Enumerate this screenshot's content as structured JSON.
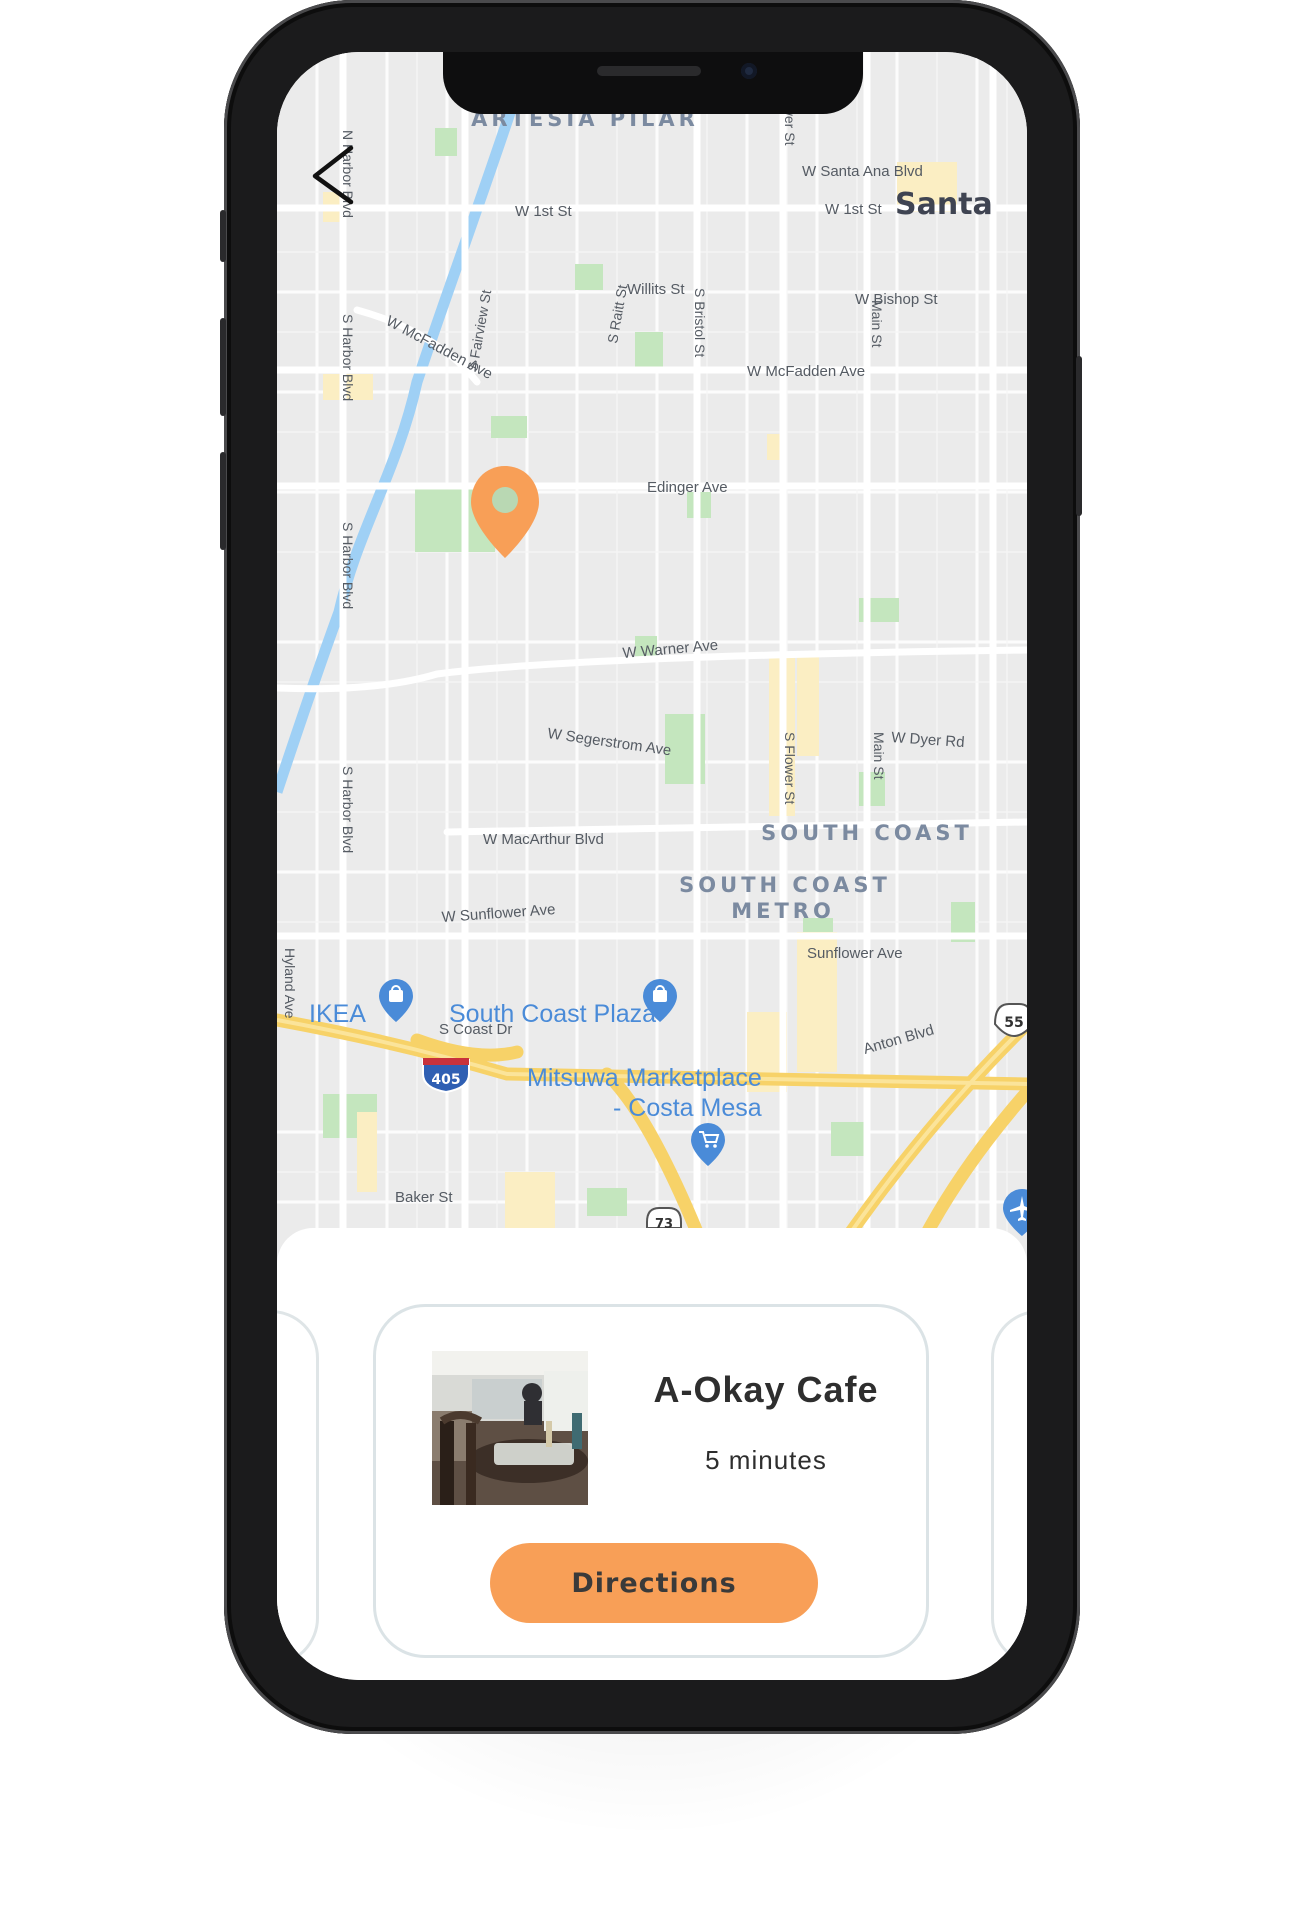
{
  "map": {
    "areas": [
      "ARTESIA PILAR",
      "SOUTH COAST",
      "SOUTH COAST",
      "METRO"
    ],
    "city_partial": "Santa",
    "streets": {
      "w_santa_ana": "W Santa Ana Blvd",
      "w_1st_a": "W 1st St",
      "w_1st_b": "W 1st St",
      "willits": "Willits St",
      "w_bishop": "W Bishop St",
      "w_mcfadden_a": "W McFadden Ave",
      "w_mcfadden_b": "W McFadden Ave",
      "edinger": "Edinger Ave",
      "w_warner": "W Warner Ave",
      "w_segerstrom": "W Segerstrom Ave",
      "w_dyer": "W Dyer Rd",
      "w_macarthur": "W MacArthur Blvd",
      "w_sunflower": "W Sunflower Ave",
      "sunflower": "Sunflower Ave",
      "s_coast": "S Coast Dr",
      "anton": "Anton Blvd",
      "baker": "Baker St",
      "n_harbor": "N Harbor Blvd",
      "s_harbor_1": "S Harbor Blvd",
      "s_harbor_2": "S Harbor Blvd",
      "s_harbor_3": "S Harbor Blvd",
      "s_fairview": "S Fairview St",
      "s_raitt": "S Raitt St",
      "s_bristol": "S Bristol St",
      "s_flower": "S Flower St",
      "main_1": "Main St",
      "main_2": "Main St",
      "hyland": "Hyland Ave",
      "flower_top": "ower St"
    },
    "places": {
      "ikea": "IKEA",
      "south_coast_plaza": "South Coast Plaza",
      "mitsuwa_1": "Mitsuwa Marketplace",
      "mitsuwa_2": "- Costa Mesa"
    },
    "shields": {
      "i405": "405",
      "r55": "55",
      "r73": "73"
    }
  },
  "card": {
    "name": "A-Okay Cafe",
    "eta": "5 minutes",
    "directions_label": "Directions"
  },
  "colors": {
    "accent": "#f89f57",
    "map_bg": "#ebebeb",
    "river": "#9fd0f5",
    "freeway": "#f7d268",
    "park": "#c4e6be",
    "poi": "#4a8bd8"
  },
  "icons": [
    "back-chevron-icon",
    "location-pin-icon",
    "shopping-bag-icon",
    "shopping-cart-icon",
    "airport-icon"
  ]
}
